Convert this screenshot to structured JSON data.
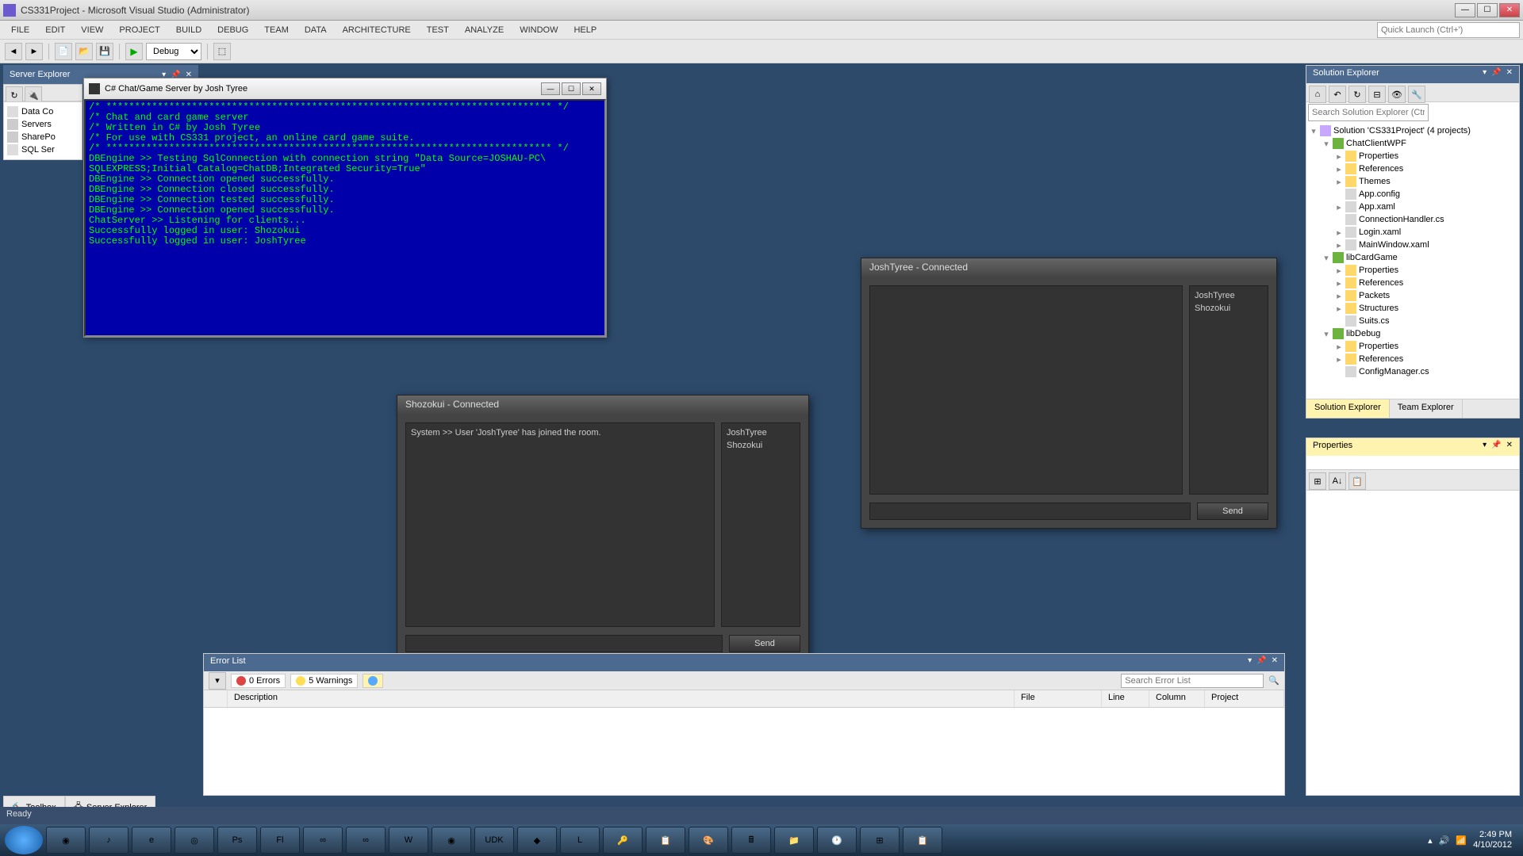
{
  "window": {
    "title": "CS331Project - Microsoft Visual Studio (Administrator)",
    "quick_launch_placeholder": "Quick Launch (Ctrl+')"
  },
  "menu": [
    "FILE",
    "EDIT",
    "VIEW",
    "PROJECT",
    "BUILD",
    "DEBUG",
    "TEAM",
    "DATA",
    "ARCHITECTURE",
    "TEST",
    "ANALYZE",
    "WINDOW",
    "HELP"
  ],
  "toolbar": {
    "config": "Debug"
  },
  "server_explorer": {
    "title": "Server Explorer",
    "items": [
      "Data Co",
      "Servers",
      "SharePo",
      "SQL Ser"
    ]
  },
  "console": {
    "title": "C# Chat/Game Server by Josh Tyree",
    "lines": [
      "/* ****************************************************************************** */",
      "/* Chat and card game server",
      "/* Written in C# by Josh Tyree",
      "/* For use with CS331 project, an online card game suite.",
      "/* ****************************************************************************** */",
      "DBEngine >> Testing SqlConnection with connection string \"Data Source=JOSHAU-PC\\",
      "SQLEXPRESS;Initial Catalog=ChatDB;Integrated Security=True\"",
      "DBEngine >> Connection opened successfully.",
      "DBEngine >> Connection closed successfully.",
      "DBEngine >> Connection tested successfully.",
      "DBEngine >> Connection opened successfully.",
      "ChatServer >> Listening for clients...",
      "Successfully logged in user: Shozokui",
      "Successfully logged in user: JoshTyree"
    ]
  },
  "chat1": {
    "title": "Shozokui - Connected",
    "msgs": [
      "System >> User 'JoshTyree' has joined the room."
    ],
    "users": [
      "JoshTyree",
      "Shozokui"
    ],
    "send": "Send"
  },
  "chat2": {
    "title": "JoshTyree - Connected",
    "msgs": [],
    "users": [
      "JoshTyree",
      "Shozokui"
    ],
    "send": "Send"
  },
  "errorlist": {
    "title": "Error List",
    "errors": "0 Errors",
    "warnings": "5 Warnings",
    "search_placeholder": "Search Error List",
    "cols": {
      "desc": "Description",
      "file": "File",
      "line": "Line",
      "col": "Column",
      "proj": "Project"
    }
  },
  "solution_explorer": {
    "title": "Solution Explorer",
    "search_placeholder": "Search Solution Explorer (Ctrl+;)",
    "root": "Solution 'CS331Project' (4 projects)",
    "tree": [
      {
        "d": 1,
        "exp": "▾",
        "ico": "proj",
        "t": "ChatClientWPF"
      },
      {
        "d": 2,
        "exp": "▸",
        "ico": "fold",
        "t": "Properties"
      },
      {
        "d": 2,
        "exp": "▸",
        "ico": "fold",
        "t": "References"
      },
      {
        "d": 2,
        "exp": "▸",
        "ico": "fold",
        "t": "Themes"
      },
      {
        "d": 2,
        "exp": "",
        "ico": "file",
        "t": "App.config"
      },
      {
        "d": 2,
        "exp": "▸",
        "ico": "file",
        "t": "App.xaml"
      },
      {
        "d": 2,
        "exp": "",
        "ico": "file",
        "t": "ConnectionHandler.cs"
      },
      {
        "d": 2,
        "exp": "▸",
        "ico": "file",
        "t": "Login.xaml"
      },
      {
        "d": 2,
        "exp": "▸",
        "ico": "file",
        "t": "MainWindow.xaml"
      },
      {
        "d": 1,
        "exp": "▾",
        "ico": "proj",
        "t": "libCardGame"
      },
      {
        "d": 2,
        "exp": "▸",
        "ico": "fold",
        "t": "Properties"
      },
      {
        "d": 2,
        "exp": "▸",
        "ico": "fold",
        "t": "References"
      },
      {
        "d": 2,
        "exp": "▸",
        "ico": "fold",
        "t": "Packets"
      },
      {
        "d": 2,
        "exp": "▸",
        "ico": "fold",
        "t": "Structures"
      },
      {
        "d": 2,
        "exp": "",
        "ico": "file",
        "t": "Suits.cs"
      },
      {
        "d": 1,
        "exp": "▾",
        "ico": "proj",
        "t": "libDebug"
      },
      {
        "d": 2,
        "exp": "▸",
        "ico": "fold",
        "t": "Properties"
      },
      {
        "d": 2,
        "exp": "▸",
        "ico": "fold",
        "t": "References"
      },
      {
        "d": 2,
        "exp": "",
        "ico": "file",
        "t": "ConfigManager.cs"
      }
    ],
    "tabs": {
      "sol": "Solution Explorer",
      "team": "Team Explorer"
    }
  },
  "properties": {
    "title": "Properties"
  },
  "bottom_tabs": {
    "toolbox": "Toolbox",
    "server": "Server Explorer"
  },
  "status": "Ready",
  "taskbar": {
    "time": "2:49 PM",
    "date": "4/10/2012"
  }
}
